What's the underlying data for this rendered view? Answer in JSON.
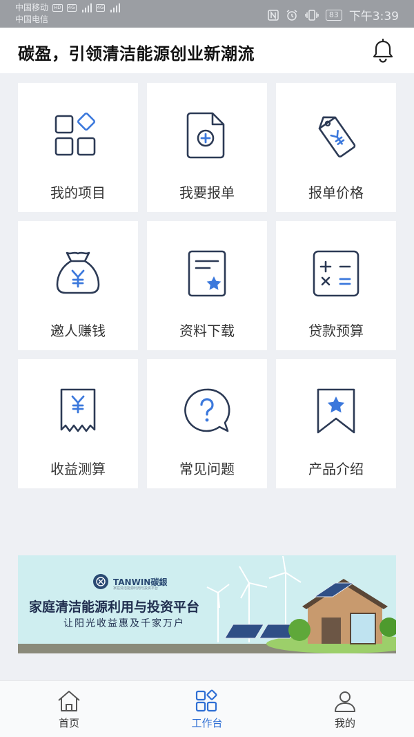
{
  "status_bar": {
    "carrier_1": "中国移动",
    "carrier_1_badge": "HD",
    "carrier_2": "中国电信",
    "network_1": "4G",
    "network_2": "4G",
    "battery": "83",
    "time": "下午3:39"
  },
  "header": {
    "title": "碳盈，引领清洁能源创业新潮流",
    "bell_icon": "bell-icon"
  },
  "grid": {
    "items": [
      {
        "label": "我的项目",
        "icon": "apps-grid-icon"
      },
      {
        "label": "我要报单",
        "icon": "document-add-icon"
      },
      {
        "label": "报单价格",
        "icon": "price-tag-icon"
      },
      {
        "label": "邀人赚钱",
        "icon": "money-bag-icon"
      },
      {
        "label": "资料下载",
        "icon": "document-star-icon"
      },
      {
        "label": "贷款预算",
        "icon": "calculator-icon"
      },
      {
        "label": "收益测算",
        "icon": "receipt-icon"
      },
      {
        "label": "常见问题",
        "icon": "question-bubble-icon"
      },
      {
        "label": "产品介绍",
        "icon": "bookmark-star-icon"
      }
    ]
  },
  "banner": {
    "brand": "TANWIN碳銀",
    "brand_sub": "家庭清洁能源利用与投资平台",
    "headline": "家庭清洁能源利用与投资平台",
    "subline": "让阳光收益惠及千家万户"
  },
  "bottom_nav": {
    "items": [
      {
        "label": "首页",
        "icon": "home-icon",
        "active": false
      },
      {
        "label": "工作台",
        "icon": "workbench-icon",
        "active": true
      },
      {
        "label": "我的",
        "icon": "user-icon",
        "active": false
      }
    ]
  },
  "colors": {
    "icon_dark": "#2c3a55",
    "accent_blue": "#3b78dc",
    "active_nav": "#2f6fd4",
    "page_bg": "#eef0f4"
  }
}
